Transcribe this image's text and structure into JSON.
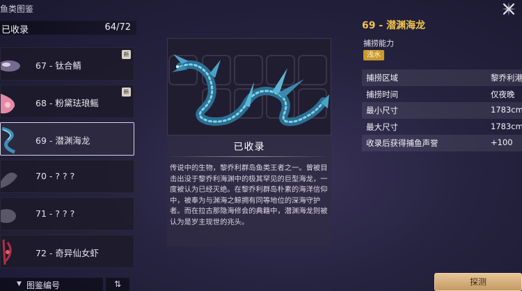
{
  "header": {
    "title": "鱼类图鉴"
  },
  "collection": {
    "label": "已收录",
    "count": "64/72"
  },
  "list": {
    "items": [
      {
        "name": "67 - 钛合鲭",
        "badge": "新",
        "thumb_color": "#8c7fa8"
      },
      {
        "name": "68 - 粉黛珐琅鳐",
        "badge": "新",
        "thumb_color": "#e58aa6"
      },
      {
        "name": "69 - 潜渊海龙",
        "badge": "",
        "thumb_color": "#3e8fb8"
      },
      {
        "name": "70 - ? ? ?",
        "badge": "",
        "thumb_color": "#5a5868"
      },
      {
        "name": "71 - ? ? ?",
        "badge": "",
        "thumb_color": "#5a5868"
      },
      {
        "name": "72 - 奇异仙女虾",
        "badge": "",
        "thumb_color": "#b03040"
      }
    ]
  },
  "sort": {
    "label": "图鉴编号",
    "toggle_icon": "⇅"
  },
  "center": {
    "status": "已收录",
    "description": "传说中的生物，黎乔利群岛鱼类王者之一。曾被目击出没于黎乔利海渊中的极其罕见的巨型海龙，一度被认为已经灭绝。在黎乔利群岛朴素的海洋信仰中，被奉为与渊海之鲸拥有同等地位的深海守护者。而在拉古那隐海修会的典籍中，潜渊海龙则被认为是岁主现世的兆头。"
  },
  "detail": {
    "title": "69 - 潜渊海龙",
    "capture_label": "捕捞能力",
    "capture_tag": "浅水",
    "stats": [
      {
        "key": "捕捞区域",
        "value": "黎乔利港"
      },
      {
        "key": "捕捞时间",
        "value": "仅夜晚"
      },
      {
        "key": "最小尺寸",
        "value": "1783cm"
      },
      {
        "key": "最大尺寸",
        "value": "1783cm"
      },
      {
        "key": "收录后获得捕鱼声誉",
        "value": "+100"
      }
    ]
  },
  "buttons": {
    "explore": "探测"
  },
  "colors": {
    "accent_gold": "#f2c44b",
    "tag_gold": "#c89a2c",
    "dragon_teal": "#4aa3c8"
  }
}
